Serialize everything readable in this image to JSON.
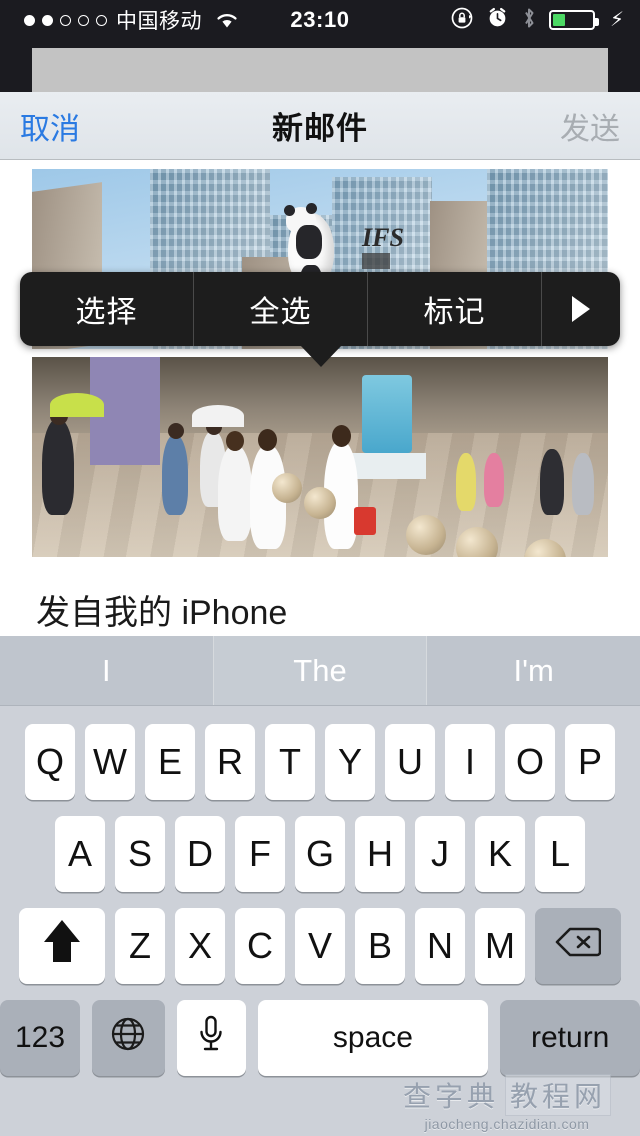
{
  "status_bar": {
    "signal_dots_filled": 2,
    "signal_dots_total": 5,
    "carrier": "中国移动",
    "wifi_icon": "wifi-icon",
    "time": "23:10",
    "rotation_lock_icon": "rotation-lock-icon",
    "alarm_icon": "alarm-clock-icon",
    "bluetooth_icon": "bluetooth-icon",
    "battery_percent": 33,
    "charging_icon": "lightning-bolt-icon",
    "battery_color": "#4cd964",
    "background_color": "#1b1b20"
  },
  "nav_bar": {
    "cancel_label": "取消",
    "title": "新邮件",
    "send_label": "发送",
    "cancel_color": "#2a7ae2",
    "send_color": "#a8adb2"
  },
  "mail_body": {
    "attachment_top_alt": "熊猫雕塑爬楼照片",
    "attachment_bottom_alt": "街道行人广场照片",
    "signature": "发自我的 iPhone"
  },
  "edit_menu": {
    "items": [
      {
        "label": "选择",
        "name": "select"
      },
      {
        "label": "全选",
        "name": "select-all"
      },
      {
        "label": "标记",
        "name": "mark"
      }
    ],
    "more_icon": "play-triangle-right-icon",
    "background_color": "#1d1d1d"
  },
  "keyboard": {
    "predictions": [
      "I",
      "The",
      "I'm"
    ],
    "row1": [
      "Q",
      "W",
      "E",
      "R",
      "T",
      "Y",
      "U",
      "I",
      "O",
      "P"
    ],
    "row2": [
      "A",
      "S",
      "D",
      "F",
      "G",
      "H",
      "J",
      "K",
      "L"
    ],
    "row3": [
      "Z",
      "X",
      "C",
      "V",
      "B",
      "N",
      "M"
    ],
    "shift_icon": "shift-arrow-icon",
    "delete_icon": "backspace-delete-icon",
    "numbers_label": "123",
    "globe_icon": "globe-language-icon",
    "mic_icon": "microphone-icon",
    "space_label": "space",
    "return_label": "return",
    "background_color": "#cdd1d8"
  },
  "watermark": {
    "line1_a": "查字典",
    "line1_b": "教程网",
    "url": "jiaocheng.chazidian.com"
  }
}
